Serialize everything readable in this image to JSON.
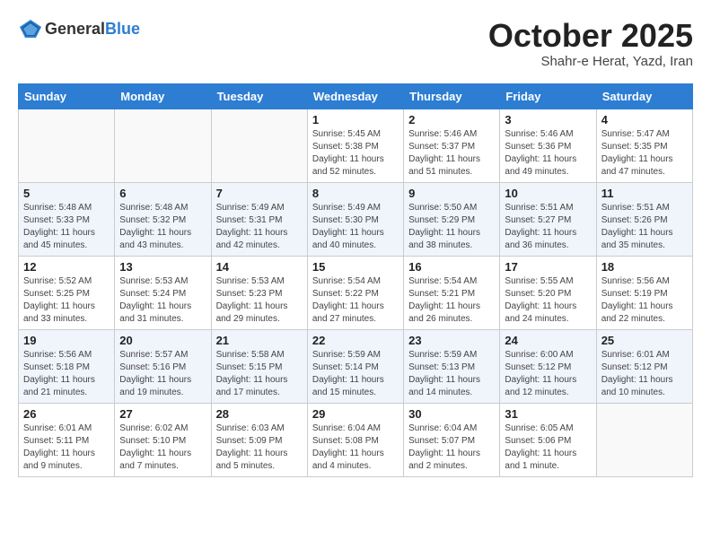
{
  "header": {
    "logo_general": "General",
    "logo_blue": "Blue",
    "month": "October 2025",
    "location": "Shahr-e Herat, Yazd, Iran"
  },
  "weekdays": [
    "Sunday",
    "Monday",
    "Tuesday",
    "Wednesday",
    "Thursday",
    "Friday",
    "Saturday"
  ],
  "weeks": [
    [
      {
        "day": "",
        "info": ""
      },
      {
        "day": "",
        "info": ""
      },
      {
        "day": "",
        "info": ""
      },
      {
        "day": "1",
        "info": "Sunrise: 5:45 AM\nSunset: 5:38 PM\nDaylight: 11 hours\nand 52 minutes."
      },
      {
        "day": "2",
        "info": "Sunrise: 5:46 AM\nSunset: 5:37 PM\nDaylight: 11 hours\nand 51 minutes."
      },
      {
        "day": "3",
        "info": "Sunrise: 5:46 AM\nSunset: 5:36 PM\nDaylight: 11 hours\nand 49 minutes."
      },
      {
        "day": "4",
        "info": "Sunrise: 5:47 AM\nSunset: 5:35 PM\nDaylight: 11 hours\nand 47 minutes."
      }
    ],
    [
      {
        "day": "5",
        "info": "Sunrise: 5:48 AM\nSunset: 5:33 PM\nDaylight: 11 hours\nand 45 minutes."
      },
      {
        "day": "6",
        "info": "Sunrise: 5:48 AM\nSunset: 5:32 PM\nDaylight: 11 hours\nand 43 minutes."
      },
      {
        "day": "7",
        "info": "Sunrise: 5:49 AM\nSunset: 5:31 PM\nDaylight: 11 hours\nand 42 minutes."
      },
      {
        "day": "8",
        "info": "Sunrise: 5:49 AM\nSunset: 5:30 PM\nDaylight: 11 hours\nand 40 minutes."
      },
      {
        "day": "9",
        "info": "Sunrise: 5:50 AM\nSunset: 5:29 PM\nDaylight: 11 hours\nand 38 minutes."
      },
      {
        "day": "10",
        "info": "Sunrise: 5:51 AM\nSunset: 5:27 PM\nDaylight: 11 hours\nand 36 minutes."
      },
      {
        "day": "11",
        "info": "Sunrise: 5:51 AM\nSunset: 5:26 PM\nDaylight: 11 hours\nand 35 minutes."
      }
    ],
    [
      {
        "day": "12",
        "info": "Sunrise: 5:52 AM\nSunset: 5:25 PM\nDaylight: 11 hours\nand 33 minutes."
      },
      {
        "day": "13",
        "info": "Sunrise: 5:53 AM\nSunset: 5:24 PM\nDaylight: 11 hours\nand 31 minutes."
      },
      {
        "day": "14",
        "info": "Sunrise: 5:53 AM\nSunset: 5:23 PM\nDaylight: 11 hours\nand 29 minutes."
      },
      {
        "day": "15",
        "info": "Sunrise: 5:54 AM\nSunset: 5:22 PM\nDaylight: 11 hours\nand 27 minutes."
      },
      {
        "day": "16",
        "info": "Sunrise: 5:54 AM\nSunset: 5:21 PM\nDaylight: 11 hours\nand 26 minutes."
      },
      {
        "day": "17",
        "info": "Sunrise: 5:55 AM\nSunset: 5:20 PM\nDaylight: 11 hours\nand 24 minutes."
      },
      {
        "day": "18",
        "info": "Sunrise: 5:56 AM\nSunset: 5:19 PM\nDaylight: 11 hours\nand 22 minutes."
      }
    ],
    [
      {
        "day": "19",
        "info": "Sunrise: 5:56 AM\nSunset: 5:18 PM\nDaylight: 11 hours\nand 21 minutes."
      },
      {
        "day": "20",
        "info": "Sunrise: 5:57 AM\nSunset: 5:16 PM\nDaylight: 11 hours\nand 19 minutes."
      },
      {
        "day": "21",
        "info": "Sunrise: 5:58 AM\nSunset: 5:15 PM\nDaylight: 11 hours\nand 17 minutes."
      },
      {
        "day": "22",
        "info": "Sunrise: 5:59 AM\nSunset: 5:14 PM\nDaylight: 11 hours\nand 15 minutes."
      },
      {
        "day": "23",
        "info": "Sunrise: 5:59 AM\nSunset: 5:13 PM\nDaylight: 11 hours\nand 14 minutes."
      },
      {
        "day": "24",
        "info": "Sunrise: 6:00 AM\nSunset: 5:12 PM\nDaylight: 11 hours\nand 12 minutes."
      },
      {
        "day": "25",
        "info": "Sunrise: 6:01 AM\nSunset: 5:12 PM\nDaylight: 11 hours\nand 10 minutes."
      }
    ],
    [
      {
        "day": "26",
        "info": "Sunrise: 6:01 AM\nSunset: 5:11 PM\nDaylight: 11 hours\nand 9 minutes."
      },
      {
        "day": "27",
        "info": "Sunrise: 6:02 AM\nSunset: 5:10 PM\nDaylight: 11 hours\nand 7 minutes."
      },
      {
        "day": "28",
        "info": "Sunrise: 6:03 AM\nSunset: 5:09 PM\nDaylight: 11 hours\nand 5 minutes."
      },
      {
        "day": "29",
        "info": "Sunrise: 6:04 AM\nSunset: 5:08 PM\nDaylight: 11 hours\nand 4 minutes."
      },
      {
        "day": "30",
        "info": "Sunrise: 6:04 AM\nSunset: 5:07 PM\nDaylight: 11 hours\nand 2 minutes."
      },
      {
        "day": "31",
        "info": "Sunrise: 6:05 AM\nSunset: 5:06 PM\nDaylight: 11 hours\nand 1 minute."
      },
      {
        "day": "",
        "info": ""
      }
    ]
  ]
}
